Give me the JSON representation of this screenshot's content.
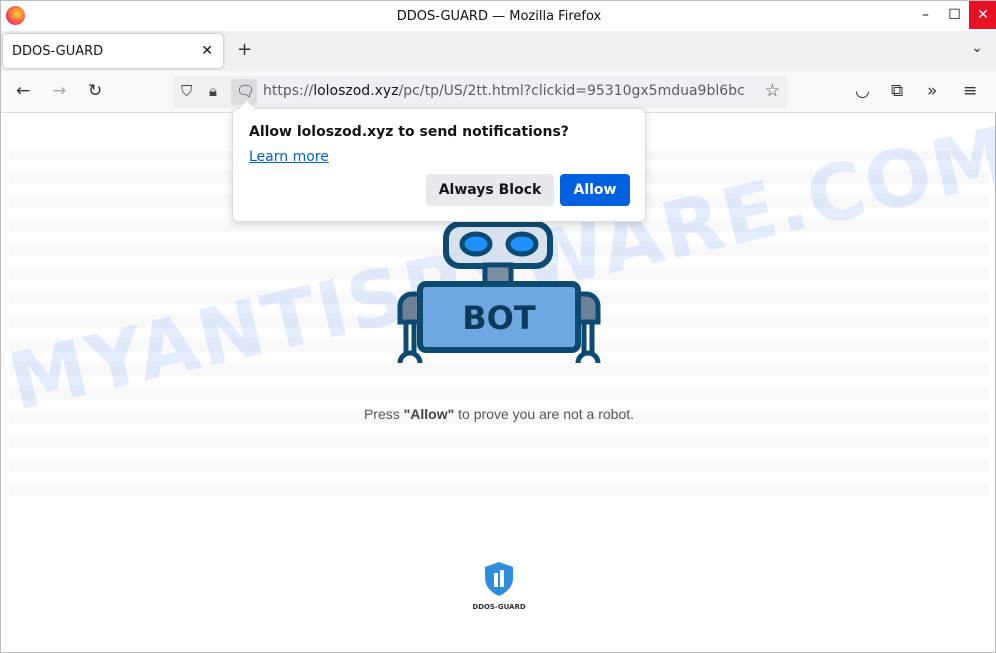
{
  "window": {
    "title": "DDOS-GUARD — Mozilla Firefox",
    "minimize": "–",
    "maximize": "☐",
    "close": "✕"
  },
  "tabs": [
    {
      "label": "DDOS-GUARD",
      "close": "✕"
    }
  ],
  "tabbar": {
    "new_tab": "+",
    "list_all": "⌄"
  },
  "nav": {
    "back": "←",
    "forward": "→",
    "reload": "↻",
    "url_prefix": "https://",
    "url_domain": "loloszod.xyz",
    "url_rest": "/pc/tp/US/2tt.html?clickid=95310gx5mdua9bl6bc",
    "bookmark": "☆",
    "pocket": "◡",
    "extensions": "⧉",
    "overflow": "»",
    "menu": "≡"
  },
  "popup": {
    "title": "Allow loloszod.xyz to send notifications?",
    "learn_more": "Learn more",
    "always_block": "Always Block",
    "allow": "Allow"
  },
  "page": {
    "robot_label": "BOT",
    "msg_pre": "Press ",
    "msg_bold": "\"Allow\"",
    "msg_post": " to prove you are not a robot.",
    "logo_text": "DDOS-GUARD",
    "watermark": "MYANTISPYWARE.COM"
  },
  "colors": {
    "accent": "#0061e0",
    "robot_dark": "#0d4a72",
    "robot_body": "#6fa8e0",
    "close": "#e81123"
  }
}
